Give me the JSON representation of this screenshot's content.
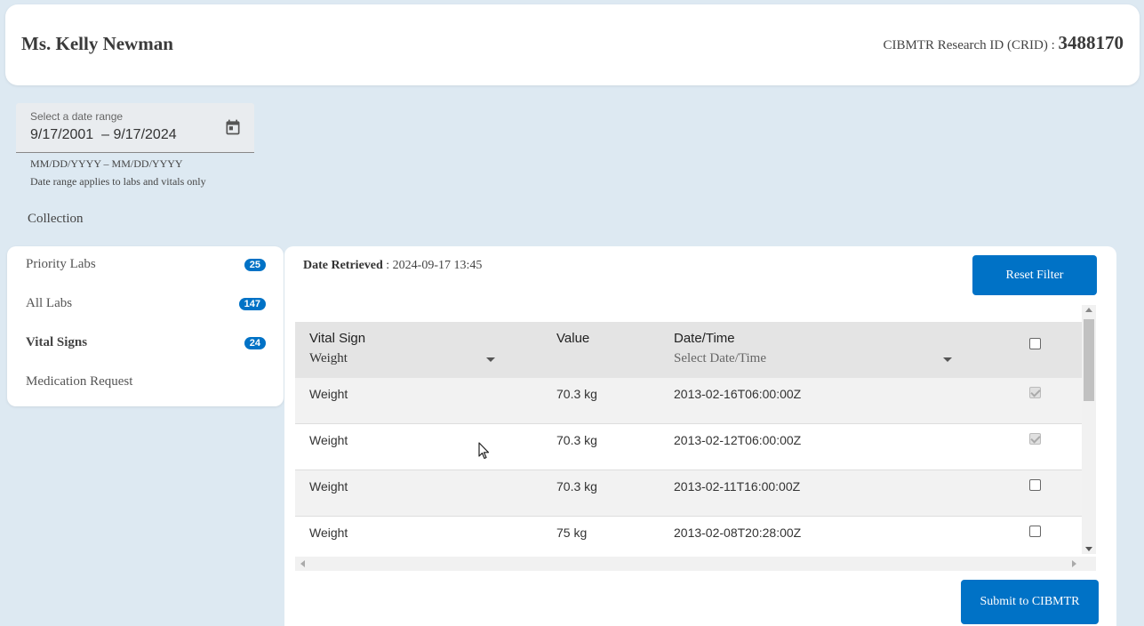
{
  "header": {
    "patient_name": "Ms. Kelly Newman",
    "crid_label": "CIBMTR Research ID (CRID) :",
    "crid_value": "3488170"
  },
  "date_range": {
    "label": "Select a date range",
    "start": "9/17/2001",
    "separator": "–",
    "end": "9/17/2024",
    "hint": "MM/DD/YYYY – MM/DD/YYYY",
    "note": "Date range applies to labs and vitals only",
    "icon": "calendar-icon"
  },
  "collection_label": "Collection",
  "sidebar": {
    "items": [
      {
        "label": "Priority Labs",
        "badge": "25",
        "active": false
      },
      {
        "label": "All Labs",
        "badge": "147",
        "active": false
      },
      {
        "label": "Vital Signs",
        "badge": "24",
        "active": true
      },
      {
        "label": "Medication Request",
        "badge": "",
        "active": false
      }
    ]
  },
  "main": {
    "retrieved_label": "Date Retrieved",
    "retrieved_value": ": 2024-09-17 13:45",
    "reset_button": "Reset Filter",
    "submit_button": "Submit to CIBMTR"
  },
  "table": {
    "columns": {
      "vital_sign": "Vital Sign",
      "value": "Value",
      "datetime": "Date/Time"
    },
    "filters": {
      "vital_sign": "Weight",
      "datetime_placeholder": "Select Date/Time"
    },
    "rows": [
      {
        "vital": "Weight",
        "value": "70.3 kg",
        "datetime": "2013-02-16T06:00:00Z",
        "checked": true
      },
      {
        "vital": "Weight",
        "value": "70.3 kg",
        "datetime": "2013-02-12T06:00:00Z",
        "checked": true
      },
      {
        "vital": "Weight",
        "value": "70.3 kg",
        "datetime": "2013-02-11T16:00:00Z",
        "checked": false
      },
      {
        "vital": "Weight",
        "value": "75 kg",
        "datetime": "2013-02-08T20:28:00Z",
        "checked": false
      }
    ]
  },
  "colors": {
    "background": "#dde9f2",
    "accent": "#0072c6"
  }
}
